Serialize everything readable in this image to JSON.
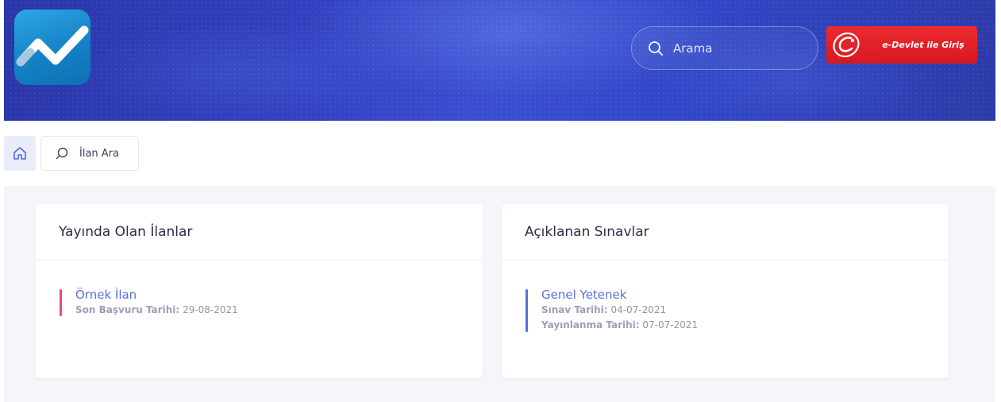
{
  "header": {
    "search": {
      "placeholder": "Arama"
    },
    "login_button": {
      "label": "e-Devlet ile Giriş"
    },
    "colors": {
      "banner": "#3340c0",
      "login": "#d71920",
      "logo": "#1582c6"
    }
  },
  "breadcrumb": {
    "home_icon": "home-icon",
    "search_tab": {
      "label": "İlan Ara",
      "icon": "search-icon"
    }
  },
  "cards": {
    "active_listings": {
      "title": "Yayında Olan İlanlar",
      "items": [
        {
          "title": "Örnek İlan",
          "deadline_label": "Son Başvuru Tarihi:",
          "deadline": "29-08-2021",
          "accent": "#e64b7a"
        }
      ]
    },
    "announced_exams": {
      "title": "Açıklanan Sınavlar",
      "items": [
        {
          "title": "Genel Yetenek",
          "exam_date_label": "Sınav Tarihi:",
          "exam_date": "04-07-2021",
          "publish_date_label": "Yayınlanma Tarihi:",
          "publish_date": "07-07-2021",
          "accent": "#5472d9"
        }
      ]
    }
  }
}
